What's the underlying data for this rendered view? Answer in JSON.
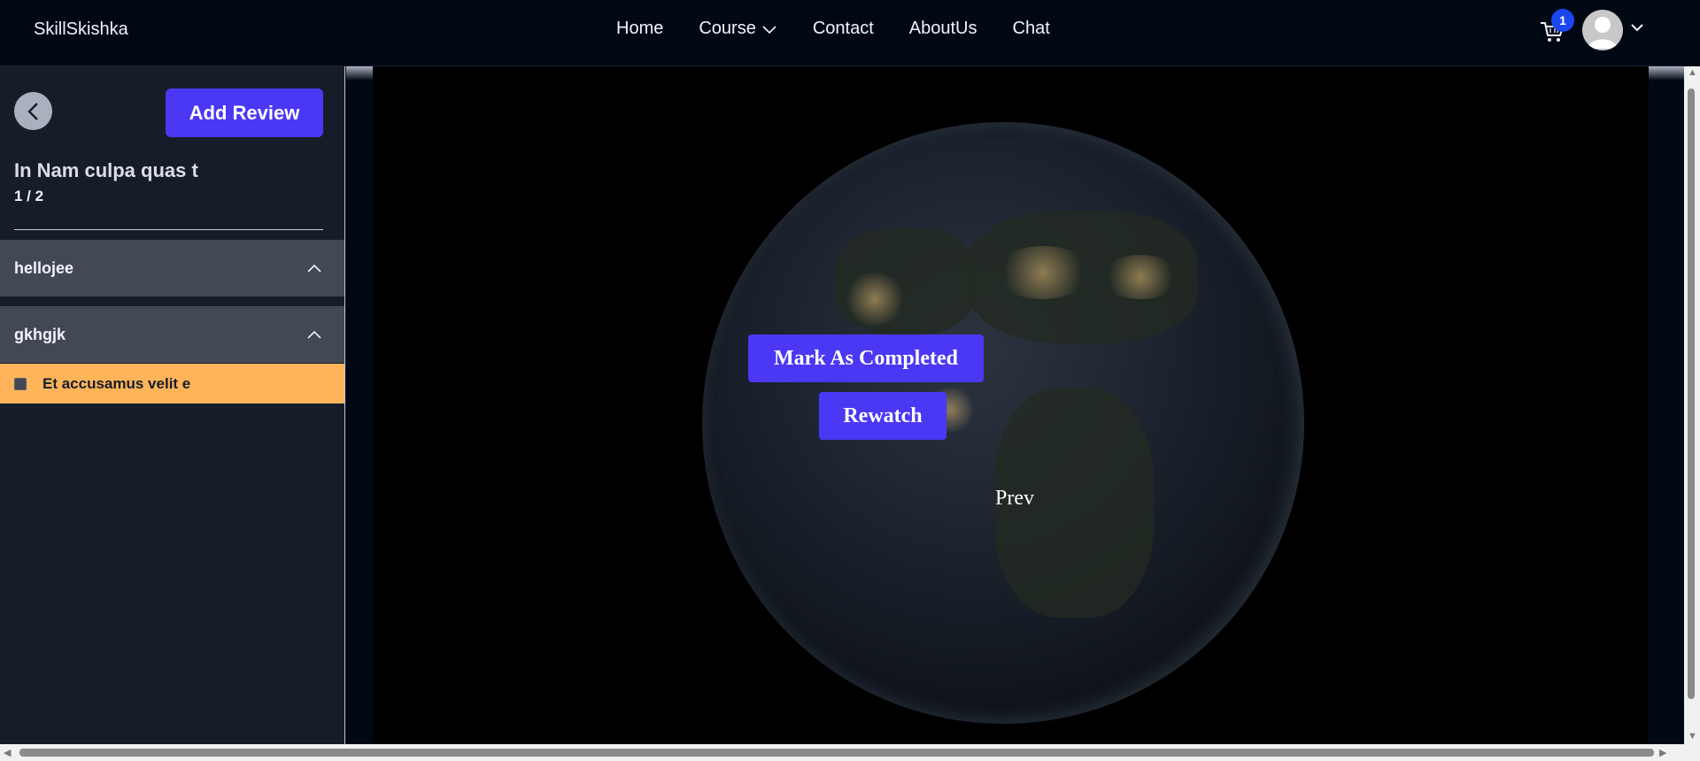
{
  "navbar": {
    "brand": "SkillSkishka",
    "links": [
      {
        "label": "Home"
      },
      {
        "label": "Course",
        "has_dropdown": true
      },
      {
        "label": "Contact"
      },
      {
        "label": "AboutUs"
      },
      {
        "label": "Chat"
      }
    ],
    "cart_count": "1",
    "icons": [
      "cart-icon",
      "avatar",
      "chevron-down-icon"
    ]
  },
  "sidebar": {
    "add_review_label": "Add Review",
    "course_title": "In Nam culpa quas t",
    "progress": "1 / 2",
    "sections": [
      {
        "label": "hellojee",
        "expanded": true
      },
      {
        "label": "gkhgjk",
        "expanded": true,
        "sub_sections": [
          {
            "label": "Et accusamus velit e",
            "completed": false,
            "active": true
          }
        ]
      }
    ]
  },
  "video": {
    "mark_completed_label": "Mark As Completed",
    "rewatch_label": "Rewatch",
    "prev_label": "Prev"
  },
  "colors": {
    "accent": "#4b38f5",
    "active_item": "#ffb45a",
    "background": "#000814",
    "sidebar": "#161d29",
    "section": "#424854",
    "badge": "#1a47f0"
  }
}
